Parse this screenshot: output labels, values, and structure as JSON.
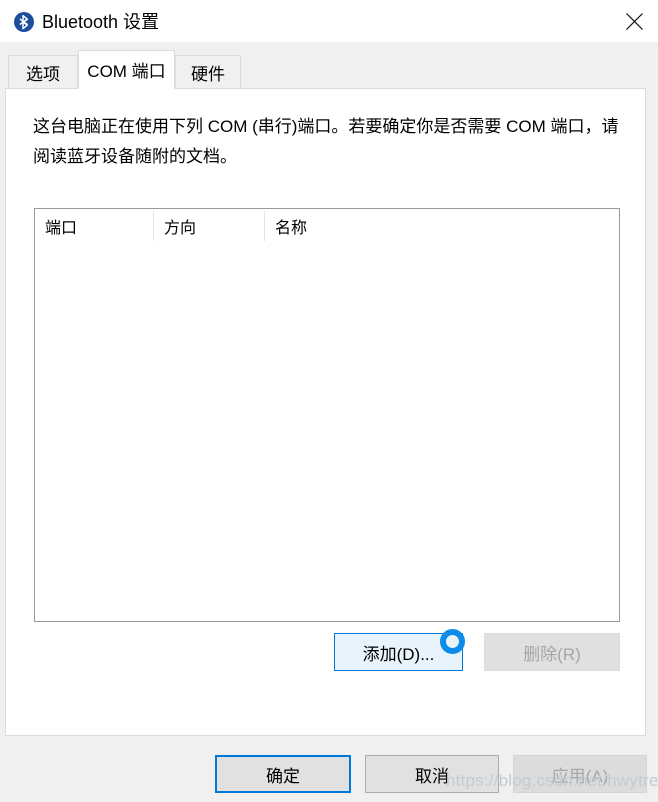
{
  "window": {
    "title": "Bluetooth 设置",
    "icon": "bluetooth-icon",
    "close_label": "✕"
  },
  "tabs": [
    {
      "label": "选项",
      "active": false
    },
    {
      "label": "COM 端口",
      "active": true
    },
    {
      "label": "硬件",
      "active": false
    }
  ],
  "page": {
    "description": "这台电脑正在使用下列 COM (串行)端口。若要确定你是否需要 COM 端口，请阅读蓝牙设备随附的文档。",
    "list": {
      "columns": [
        "端口",
        "方向",
        "名称"
      ],
      "rows": []
    },
    "buttons": {
      "add": "添加(D)...",
      "remove": "删除(R)"
    }
  },
  "footer": {
    "ok": "确定",
    "cancel": "取消",
    "apply": "应用(A)"
  },
  "watermark": "https://blog.csdn.net/hwytree",
  "colors": {
    "accent": "#0078d7",
    "cursor_ring": "#0c8ce9",
    "disabled_text": "#a6a6a6",
    "body_bg": "#f0f0f0",
    "panel_bg": "#ffffff"
  }
}
